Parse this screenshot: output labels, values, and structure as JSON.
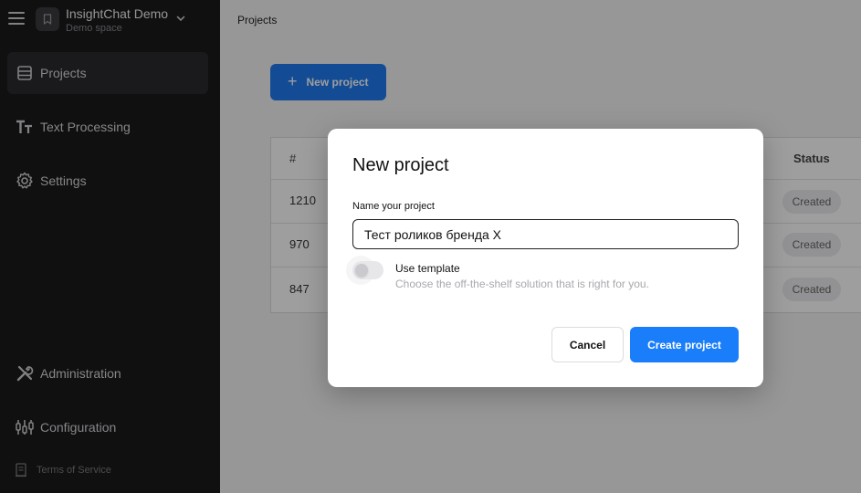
{
  "workspace": {
    "name": "InsightChat Demo",
    "subtitle": "Demo space"
  },
  "sidebar": {
    "items": [
      {
        "label": "Projects",
        "icon": "projects-icon",
        "active": true
      },
      {
        "label": "Text Processing",
        "icon": "text-processing-icon",
        "active": false
      },
      {
        "label": "Settings",
        "icon": "gear-icon",
        "active": false
      }
    ],
    "bottom_items": [
      {
        "label": "Administration",
        "icon": "tools-icon"
      },
      {
        "label": "Configuration",
        "icon": "sliders-icon"
      }
    ],
    "terms_label": "Terms of Service"
  },
  "main": {
    "breadcrumb": "Projects",
    "new_project_label": "New project",
    "table": {
      "headers": {
        "id": "#",
        "status": "Status"
      },
      "rows": [
        {
          "id": "1210",
          "status": "Created"
        },
        {
          "id": "970",
          "status": "Created"
        },
        {
          "id": "847",
          "status": "Created"
        }
      ]
    }
  },
  "modal": {
    "title": "New project",
    "name_label": "Name your project",
    "name_value": "Тест роликов бренда X",
    "template_title": "Use template",
    "template_desc": "Choose the off-the-shelf solution that is right for you.",
    "cancel_label": "Cancel",
    "create_label": "Create project"
  },
  "colors": {
    "accent": "#1a7dfa",
    "sidebar_bg": "#1a1a1c"
  }
}
